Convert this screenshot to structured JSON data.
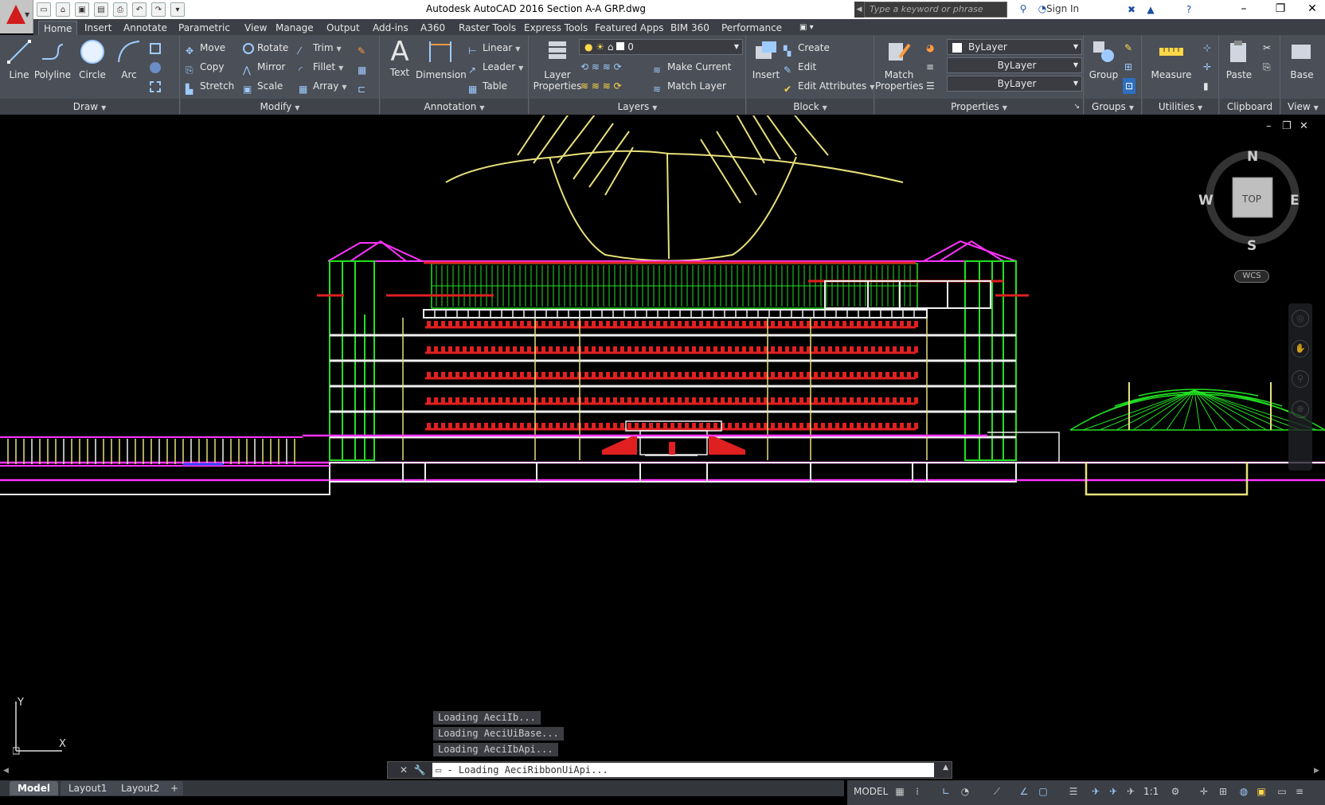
{
  "window": {
    "title": "Autodesk AutoCAD 2016    Section A-A GRP.dwg",
    "search_placeholder": "Type a keyword or phrase",
    "sign_in": "Sign In",
    "minimize": "–",
    "maximize": "❐",
    "close": "✕"
  },
  "tabs": [
    "Home",
    "Insert",
    "Annotate",
    "Parametric",
    "View",
    "Manage",
    "Output",
    "Add-ins",
    "A360",
    "Raster Tools",
    "Express Tools",
    "Featured Apps",
    "BIM 360",
    "Performance"
  ],
  "ribbon": {
    "draw": {
      "title": "Draw",
      "line": "Line",
      "polyline": "Polyline",
      "circle": "Circle",
      "arc": "Arc"
    },
    "modify": {
      "title": "Modify",
      "move": "Move",
      "rotate": "Rotate",
      "trim": "Trim",
      "copy": "Copy",
      "mirror": "Mirror",
      "fillet": "Fillet",
      "stretch": "Stretch",
      "scale": "Scale",
      "array": "Array"
    },
    "annotation": {
      "title": "Annotation",
      "text": "Text",
      "dimension": "Dimension",
      "linear": "Linear",
      "leader": "Leader",
      "table": "Table"
    },
    "layers": {
      "title": "Layers",
      "layer_properties_1": "Layer",
      "layer_properties_2": "Properties",
      "current_layer": "0",
      "make_current": "Make Current",
      "match_layer": "Match Layer"
    },
    "block": {
      "title": "Block",
      "insert": "Insert",
      "create": "Create",
      "edit": "Edit",
      "edit_attributes": "Edit Attributes"
    },
    "properties": {
      "title": "Properties",
      "match_1": "Match",
      "match_2": "Properties",
      "color": "ByLayer",
      "linetype": "ByLayer",
      "lineweight": "ByLayer"
    },
    "groups": {
      "title": "Groups",
      "group": "Group"
    },
    "utilities": {
      "title": "Utilities",
      "measure": "Measure"
    },
    "clipboard": {
      "title": "Clipboard",
      "paste": "Paste"
    },
    "view": {
      "title": "View",
      "base": "Base"
    }
  },
  "viewcube": {
    "n": "N",
    "s": "S",
    "e": "E",
    "w": "W",
    "top": "TOP",
    "wcs": "WCS"
  },
  "ucs": {
    "x": "X",
    "y": "Y"
  },
  "messages": [
    "Loading AeciIb...",
    "Loading AeciUiBase...",
    "Loading AeciIbApi..."
  ],
  "command_line": "- Loading AeciRibbonUiApi...",
  "layout_tabs": [
    "Model",
    "Layout1",
    "Layout2",
    "+"
  ],
  "status": {
    "model": "MODEL",
    "scale": "1:1"
  },
  "colors": {
    "ribbon": "#4b4f57",
    "canvas": "#000000",
    "green": "#22e022",
    "red": "#e02020",
    "magenta": "#ff33ff",
    "yellow": "#e8e07a",
    "white": "#f0f0f0"
  }
}
